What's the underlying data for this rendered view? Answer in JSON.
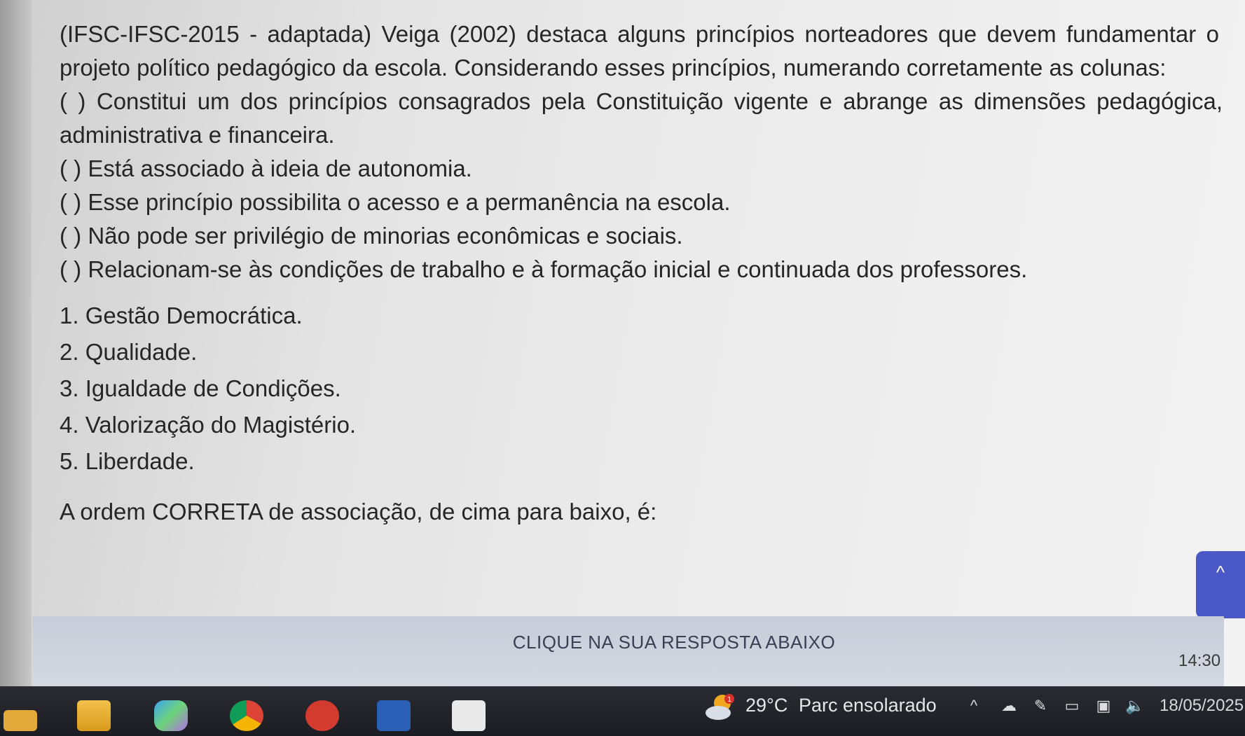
{
  "question": {
    "intro": "(IFSC-IFSC-2015 - adaptada) Veiga (2002) destaca alguns princípios norteadores que devem fundamentar o projeto político pedagógico da escola. Considerando esses princípios, numerando corretamente as colunas:",
    "statements": [
      "( ) Constitui um dos princípios consagrados pela Constituição vigente e abrange as dimensões pedagógica, administrativa e financeira.",
      "( ) Está associado à ideia de autonomia.",
      "( ) Esse princípio possibilita o acesso e a permanência na escola.",
      "( ) Não pode ser privilégio de minorias econômicas e sociais.",
      "( ) Relacionam-se às condições de trabalho e à formação inicial e continuada dos professores."
    ],
    "options": [
      "1. Gestão Democrática.",
      "2. Qualidade.",
      "3. Igualdade de Condições.",
      "4. Valorização do Magistério.",
      "5. Liberdade."
    ],
    "prompt": "A ordem CORRETA de associação, de cima para baixo, é:"
  },
  "answer_bar": {
    "label": "CLIQUE NA SUA RESPOSTA ABAIXO"
  },
  "scroll_top": {
    "icon": "chevron-up-icon",
    "glyph": "^"
  },
  "taskbar": {
    "apps": [
      "start-icon",
      "file-explorer-icon",
      "copilot-icon",
      "chrome-icon",
      "app-red-icon",
      "word-icon",
      "app-font-icon"
    ],
    "weather": {
      "badge": "1",
      "temperature": "29°C",
      "description": "Parc ensolarado"
    },
    "clock": {
      "time": "14:30",
      "date": "18/05/2025"
    }
  },
  "colors": {
    "accent": "#4b58c8",
    "taskbar": "#1f2026"
  }
}
